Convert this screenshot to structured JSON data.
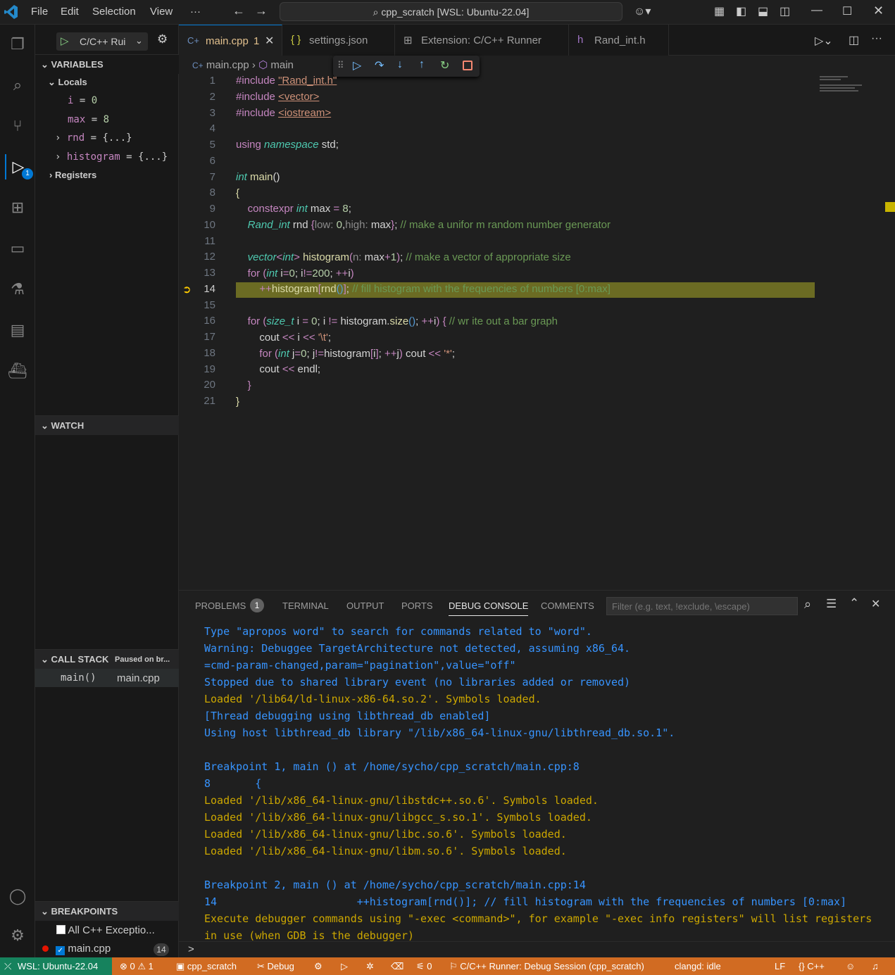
{
  "titlebar": {
    "menu": [
      "File",
      "Edit",
      "Selection",
      "View",
      "···"
    ],
    "search": "cpp_scratch [WSL: Ubuntu-22.04]"
  },
  "activity": {
    "debug_badge": "1"
  },
  "sidebar": {
    "run_config": "C/C++ Rui",
    "variables_title": "VARIABLES",
    "locals_label": "Locals",
    "vars": [
      {
        "name": "i",
        "value": "0"
      },
      {
        "name": "max",
        "value": "8"
      },
      {
        "name": "rnd",
        "value": "{...}"
      },
      {
        "name": "histogram",
        "value": "{...}"
      }
    ],
    "registers_label": "Registers",
    "watch_title": "WATCH",
    "callstack_title": "CALL STACK",
    "callstack_status": "Paused on br...",
    "frame_fn": "main()",
    "frame_file": "main.cpp",
    "breakpoints_title": "BREAKPOINTS",
    "bp_exceptions": "All C++ Exceptio...",
    "bp_file": "main.cpp",
    "bp_line": "14"
  },
  "tabs": [
    {
      "label": "main.cpp",
      "suffix": "1"
    },
    {
      "label": "settings.json"
    },
    {
      "label": "Extension: C/C++ Runner"
    },
    {
      "label": "Rand_int.h"
    }
  ],
  "breadcrumb": {
    "file": "main.cpp",
    "symbol": "main"
  },
  "editor": {
    "line_numbers": [
      "1",
      "2",
      "3",
      "4",
      "5",
      "6",
      "7",
      "8",
      "9",
      "10",
      "11",
      "12",
      "13",
      "14",
      "15",
      "16",
      "17",
      "18",
      "19",
      "20",
      "21"
    ],
    "current_line": "14"
  },
  "panel": {
    "tabs": [
      "PROBLEMS",
      "TERMINAL",
      "OUTPUT",
      "PORTS",
      "DEBUG CONSOLE",
      "COMMENTS"
    ],
    "problems_count": "1",
    "filter_placeholder": "Filter (e.g. text, !exclude, \\escape)",
    "console": [
      {
        "text": "Type \"apropos word\" to search for commands related to \"word\".",
        "c": "b"
      },
      {
        "text": "Warning: Debuggee TargetArchitecture not detected, assuming x86_64.",
        "c": "b"
      },
      {
        "text": "=cmd-param-changed,param=\"pagination\",value=\"off\"",
        "c": "b"
      },
      {
        "text": "Stopped due to shared library event (no libraries added or removed)",
        "c": "b"
      },
      {
        "text": "Loaded '/lib64/ld-linux-x86-64.so.2'. Symbols loaded.",
        "c": "y"
      },
      {
        "text": "[Thread debugging using libthread_db enabled]",
        "c": "b"
      },
      {
        "text": "Using host libthread_db library \"/lib/x86_64-linux-gnu/libthread_db.so.1\".",
        "c": "b"
      },
      {
        "text": "",
        "c": "b"
      },
      {
        "text": "Breakpoint 1, main () at /home/sycho/cpp_scratch/main.cpp:8",
        "c": "b"
      },
      {
        "text": "8       {",
        "c": "b"
      },
      {
        "text": "Loaded '/lib/x86_64-linux-gnu/libstdc++.so.6'. Symbols loaded.",
        "c": "y"
      },
      {
        "text": "Loaded '/lib/x86_64-linux-gnu/libgcc_s.so.1'. Symbols loaded.",
        "c": "y"
      },
      {
        "text": "Loaded '/lib/x86_64-linux-gnu/libc.so.6'. Symbols loaded.",
        "c": "y"
      },
      {
        "text": "Loaded '/lib/x86_64-linux-gnu/libm.so.6'. Symbols loaded.",
        "c": "y"
      },
      {
        "text": "",
        "c": "b"
      },
      {
        "text": "Breakpoint 2, main () at /home/sycho/cpp_scratch/main.cpp:14",
        "c": "b"
      },
      {
        "text": "14                      ++histogram[rnd()]; // fill histogram with the frequencies of numbers [0:max]",
        "c": "b"
      },
      {
        "text": "Execute debugger commands using \"-exec <command>\", for example \"-exec info registers\" will list registers",
        "c": "y"
      },
      {
        "text": "in use (when GDB is the debugger)",
        "c": "y"
      }
    ],
    "prompt": ">"
  },
  "status": {
    "remote": "WSL: Ubuntu-22.04",
    "errors": "0",
    "warnings": "1",
    "folder": "cpp_scratch",
    "debug": "Debug",
    "ports": "0",
    "session": "C/C++ Runner: Debug Session (cpp_scratch)",
    "clangd": "clangd: idle",
    "eol": "LF",
    "lang": "C++"
  }
}
